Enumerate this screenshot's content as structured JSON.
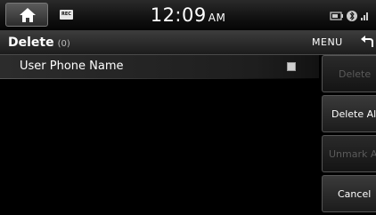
{
  "status_bar": {
    "rec_label": "REC",
    "time": "12:09",
    "ampm": "AM",
    "icons": [
      "home-icon",
      "phone-battery-icon",
      "bluetooth-icon",
      "signal-icon"
    ]
  },
  "title_bar": {
    "title": "Delete",
    "count": "(0)",
    "menu_label": "MENU",
    "back_icon": "back-arrow-icon"
  },
  "list": {
    "items": [
      {
        "label": "User Phone Name",
        "checked": false
      }
    ]
  },
  "side_buttons": {
    "delete": "Delete",
    "delete_all": "Delete All",
    "unmark_all": "Unmark All",
    "cancel": "Cancel"
  }
}
